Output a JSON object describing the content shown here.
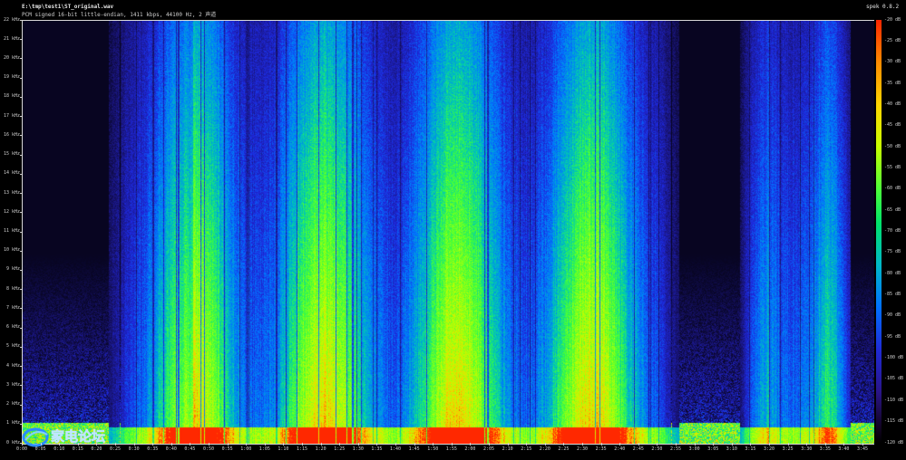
{
  "window": {
    "file_path": "E:\\tmp\\test1\\ST_original.wav",
    "audio_info": "PCM signed 16-bit little-endian, 1411 kbps, 44100 Hz, 2 声道",
    "app_name": "spek 0.8.2"
  },
  "frequency_axis": {
    "labels": [
      "22 kHz",
      "21 kHz",
      "20 kHz",
      "19 kHz",
      "18 kHz",
      "17 kHz",
      "16 kHz",
      "15 kHz",
      "14 kHz",
      "13 kHz",
      "12 kHz",
      "11 kHz",
      "10 kHz",
      "9 kHz",
      "8 kHz",
      "7 kHz",
      "6 kHz",
      "5 kHz",
      "4 kHz",
      "3 kHz",
      "2 kHz",
      "1 kHz",
      "0 kHz"
    ]
  },
  "time_axis": {
    "labels": [
      "0:00",
      "0:05",
      "0:10",
      "0:15",
      "0:20",
      "0:25",
      "0:30",
      "0:35",
      "0:40",
      "0:45",
      "0:50",
      "0:55",
      "1:00",
      "1:05",
      "1:10",
      "1:15",
      "1:20",
      "1:25",
      "1:30",
      "1:35",
      "1:40",
      "1:45",
      "1:50",
      "1:55",
      "2:00",
      "2:05",
      "2:10",
      "2:15",
      "2:20",
      "2:25",
      "2:30",
      "2:35",
      "2:40",
      "2:45",
      "2:50",
      "2:55",
      "3:00",
      "3:05",
      "3:10",
      "3:15",
      "3:20",
      "3:25",
      "3:30",
      "3:35",
      "3:40",
      "3:45"
    ]
  },
  "db_scale": {
    "labels": [
      "-20 dB",
      "-25 dB",
      "-30 dB",
      "-35 dB",
      "-40 dB",
      "-45 dB",
      "-50 dB",
      "-55 dB",
      "-60 dB",
      "-65 dB",
      "-70 dB",
      "-75 dB",
      "-80 dB",
      "-85 dB",
      "-90 dB",
      "-95 dB",
      "-100 dB",
      "-105 dB",
      "-110 dB",
      "-115 dB",
      "-120 dB"
    ]
  },
  "watermark": {
    "text": "家电论坛",
    "icon": "forum-logo-icon"
  },
  "spectrogram": {
    "music_segments": [
      [
        0.085,
        0.77
      ],
      [
        0.835,
        0.972
      ]
    ],
    "colors": {
      "hot": "#ff2a00",
      "warm": "#ffd000",
      "mid": "#3cff3c",
      "cool": "#00b4ff",
      "cold": "#2222dd",
      "silence": "#050315"
    }
  }
}
